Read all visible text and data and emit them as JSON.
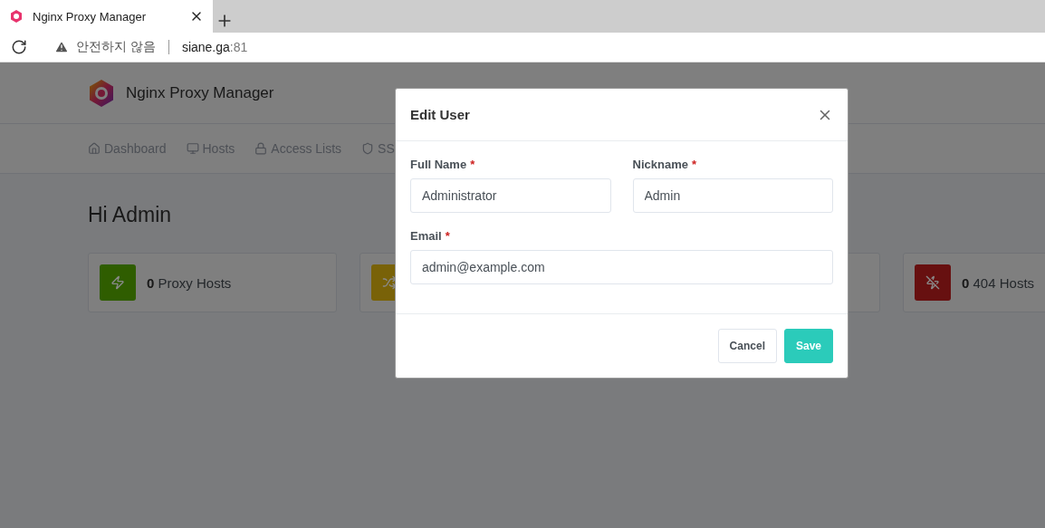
{
  "browser": {
    "tab_title": "Nginx Proxy Manager",
    "security_label": "안전하지 않음",
    "url_host": "siane.ga",
    "url_port": ":81"
  },
  "app": {
    "brand": "Nginx Proxy Manager",
    "nav": [
      {
        "kind": "home",
        "label": "Dashboard"
      },
      {
        "kind": "monitor",
        "label": "Hosts"
      },
      {
        "kind": "lock",
        "label": "Access Lists"
      },
      {
        "kind": "shield",
        "label": "SS"
      }
    ],
    "greeting": "Hi Admin",
    "cards": [
      {
        "kind": "proxy",
        "color": "#2f5d00",
        "count": "0",
        "label": "Proxy Hosts"
      },
      {
        "kind": "redirect",
        "color": "#796208"
      },
      {
        "kind": "stream"
      },
      {
        "kind": "dead",
        "color": "#671010",
        "count": "0",
        "label": "404 Hosts"
      }
    ]
  },
  "dialog": {
    "title": "Edit User",
    "required_mark": "*",
    "fields": [
      {
        "label": "Full Name",
        "required": true,
        "value": "Administrator"
      },
      {
        "label": "Nickname",
        "required": true,
        "value": "Admin"
      },
      {
        "label": "Email",
        "required": true,
        "value": "admin@example.com"
      }
    ],
    "buttons": [
      {
        "kind": "secondary",
        "label": "Cancel"
      },
      {
        "kind": "primary",
        "label": "Save"
      }
    ]
  }
}
